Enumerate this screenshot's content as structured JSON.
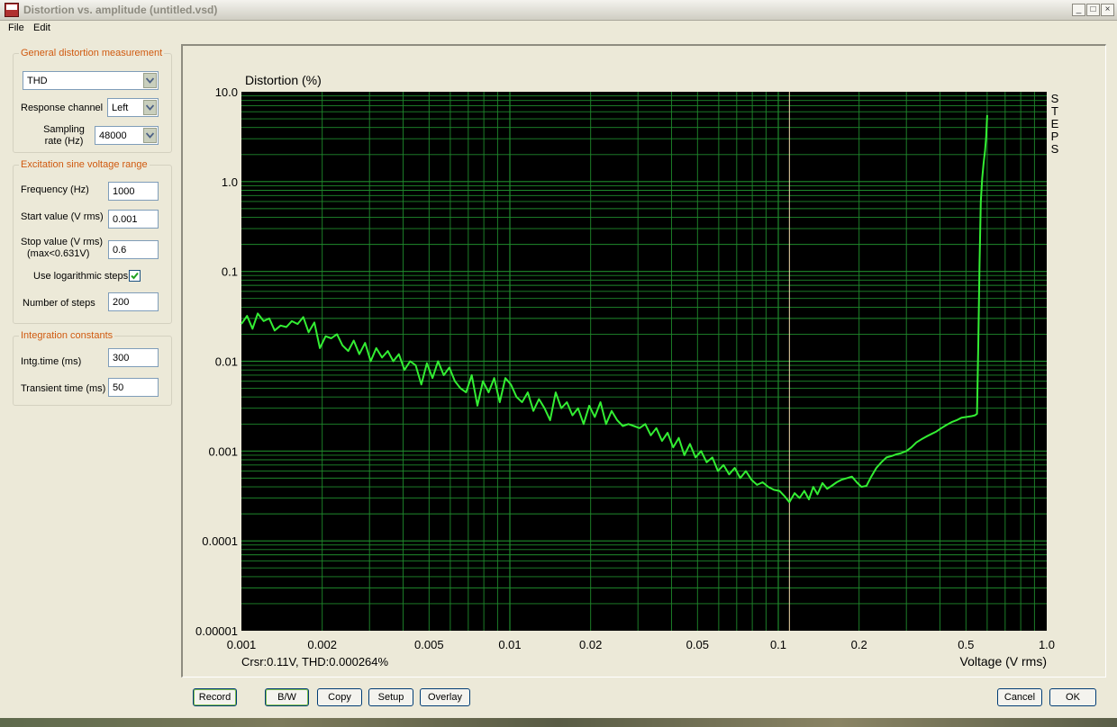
{
  "window": {
    "title": "Distortion vs. amplitude (untitled.vsd)",
    "app_icon_text": "Step"
  },
  "window_buttons": {
    "minimize": "_",
    "maximize": "□",
    "close": "×"
  },
  "menu": [
    "File",
    "Edit"
  ],
  "general": {
    "group_title": "General distortion measurement",
    "measurement_value": "THD",
    "response_channel_label": "Response channel",
    "response_channel_value": "Left",
    "sampling_rate_label_1": "Sampling",
    "sampling_rate_label_2": "rate (Hz)",
    "sampling_rate_value": "48000"
  },
  "excitation": {
    "group_title": "Excitation sine voltage range",
    "frequency_label": "Frequency (Hz)",
    "frequency_value": "1000",
    "start_label": "Start value (V rms)",
    "start_value": "0.001",
    "stop_label_1": "Stop value (V rms)",
    "stop_label_2": "(max<0.631V)",
    "stop_value": "0.6",
    "log_steps_label": "Use logarithmic steps",
    "log_steps_checked": true,
    "steps_label": "Number of steps",
    "steps_value": "200"
  },
  "integration": {
    "group_title": "Integration constants",
    "intg_label": "Intg.time (ms)",
    "intg_value": "300",
    "transient_label": "Transient time (ms)",
    "transient_value": "50"
  },
  "chart": {
    "cursor_readout": "Crsr:0.11V, THD:0.000264%",
    "side_label": [
      "S",
      "T",
      "E",
      "P",
      "S"
    ]
  },
  "buttons": {
    "record": "Record",
    "bw": "B/W",
    "copy": "Copy",
    "setup": "Setup",
    "overlay": "Overlay",
    "cancel": "Cancel",
    "ok": "OK"
  },
  "colors": {
    "plot_background": "#000000",
    "grid": "#1f8a2c",
    "trace": "#33ee33",
    "cursor_line": "#f0d8a8",
    "group_title": "#d05a10"
  },
  "chart_data": {
    "type": "line",
    "title": "",
    "ylabel": "Distortion (%)",
    "xlabel": "Voltage (V rms)",
    "x_scale": "log",
    "y_scale": "log",
    "xlim": [
      0.001,
      1.0
    ],
    "ylim": [
      1e-05,
      10.0
    ],
    "grid": true,
    "x_ticks": [
      {
        "value": 0.001,
        "label": "0.001"
      },
      {
        "value": 0.002,
        "label": "0.002"
      },
      {
        "value": 0.005,
        "label": "0.005"
      },
      {
        "value": 0.01,
        "label": "0.01"
      },
      {
        "value": 0.02,
        "label": "0.02"
      },
      {
        "value": 0.05,
        "label": "0.05"
      },
      {
        "value": 0.1,
        "label": "0.1"
      },
      {
        "value": 0.2,
        "label": "0.2"
      },
      {
        "value": 0.5,
        "label": "0.5"
      },
      {
        "value": 1.0,
        "label": "1.0"
      }
    ],
    "y_ticks": [
      {
        "value": 10,
        "label": "10.0"
      },
      {
        "value": 1,
        "label": "1.0"
      },
      {
        "value": 0.1,
        "label": "0.1"
      },
      {
        "value": 0.01,
        "label": "0.01"
      },
      {
        "value": 0.001,
        "label": "0.001"
      },
      {
        "value": 0.0001,
        "label": "0.0001"
      },
      {
        "value": 1e-05,
        "label": "0.00001"
      }
    ],
    "cursor_x": 0.11,
    "series": [
      {
        "points": [
          [
            0.001,
            0.026
          ],
          [
            0.00105,
            0.032
          ],
          [
            0.0011,
            0.023
          ],
          [
            0.00115,
            0.034
          ],
          [
            0.00121,
            0.028
          ],
          [
            0.00127,
            0.03
          ],
          [
            0.00133,
            0.022
          ],
          [
            0.0014,
            0.025
          ],
          [
            0.00147,
            0.024
          ],
          [
            0.00154,
            0.028
          ],
          [
            0.00162,
            0.026
          ],
          [
            0.0017,
            0.031
          ],
          [
            0.00178,
            0.021
          ],
          [
            0.00187,
            0.027
          ],
          [
            0.00196,
            0.014
          ],
          [
            0.00206,
            0.019
          ],
          [
            0.00216,
            0.018
          ],
          [
            0.00227,
            0.02
          ],
          [
            0.00238,
            0.015
          ],
          [
            0.0025,
            0.013
          ],
          [
            0.00262,
            0.017
          ],
          [
            0.00275,
            0.012
          ],
          [
            0.00289,
            0.016
          ],
          [
            0.00303,
            0.01
          ],
          [
            0.00318,
            0.014
          ],
          [
            0.00334,
            0.011
          ],
          [
            0.00351,
            0.013
          ],
          [
            0.00368,
            0.01
          ],
          [
            0.00386,
            0.012
          ],
          [
            0.00405,
            0.008
          ],
          [
            0.00425,
            0.01
          ],
          [
            0.00446,
            0.009
          ],
          [
            0.00468,
            0.0055
          ],
          [
            0.00491,
            0.0095
          ],
          [
            0.00515,
            0.0065
          ],
          [
            0.0054,
            0.01
          ],
          [
            0.00567,
            0.007
          ],
          [
            0.00595,
            0.0085
          ],
          [
            0.00624,
            0.006
          ],
          [
            0.00655,
            0.005
          ],
          [
            0.00687,
            0.0045
          ],
          [
            0.00721,
            0.007
          ],
          [
            0.00757,
            0.0032
          ],
          [
            0.00794,
            0.006
          ],
          [
            0.00833,
            0.0045
          ],
          [
            0.00874,
            0.0065
          ],
          [
            0.00917,
            0.0035
          ],
          [
            0.00962,
            0.0065
          ],
          [
            0.01009,
            0.0055
          ],
          [
            0.01059,
            0.004
          ],
          [
            0.01111,
            0.0035
          ],
          [
            0.01166,
            0.0045
          ],
          [
            0.01223,
            0.0028
          ],
          [
            0.01283,
            0.0038
          ],
          [
            0.01346,
            0.003
          ],
          [
            0.01412,
            0.0022
          ],
          [
            0.01482,
            0.0045
          ],
          [
            0.01555,
            0.003
          ],
          [
            0.01631,
            0.0035
          ],
          [
            0.01711,
            0.0025
          ],
          [
            0.01795,
            0.003
          ],
          [
            0.01883,
            0.002
          ],
          [
            0.01976,
            0.0032
          ],
          [
            0.02073,
            0.0024
          ],
          [
            0.02175,
            0.0035
          ],
          [
            0.02282,
            0.002
          ],
          [
            0.02394,
            0.0028
          ],
          [
            0.02512,
            0.0022
          ],
          [
            0.02635,
            0.0019
          ],
          [
            0.02765,
            0.002
          ],
          [
            0.02901,
            0.0019
          ],
          [
            0.03043,
            0.0018
          ],
          [
            0.03193,
            0.002
          ],
          [
            0.0335,
            0.0015
          ],
          [
            0.03514,
            0.0018
          ],
          [
            0.03687,
            0.0013
          ],
          [
            0.03868,
            0.0016
          ],
          [
            0.04058,
            0.0011
          ],
          [
            0.04258,
            0.0014
          ],
          [
            0.04467,
            0.0009
          ],
          [
            0.04687,
            0.0012
          ],
          [
            0.04917,
            0.00085
          ],
          [
            0.05159,
            0.001
          ],
          [
            0.05412,
            0.00075
          ],
          [
            0.05678,
            0.00085
          ],
          [
            0.05957,
            0.0006
          ],
          [
            0.0625,
            0.0007
          ],
          [
            0.06557,
            0.00055
          ],
          [
            0.06879,
            0.00065
          ],
          [
            0.07217,
            0.0005
          ],
          [
            0.07572,
            0.0006
          ],
          [
            0.07944,
            0.00048
          ],
          [
            0.08334,
            0.00042
          ],
          [
            0.08744,
            0.00045
          ],
          [
            0.09174,
            0.0004
          ],
          [
            0.09625,
            0.00037
          ],
          [
            0.10098,
            0.00036
          ],
          [
            0.10594,
            0.00031
          ],
          [
            0.11,
            0.00027
          ],
          [
            0.115,
            0.00034
          ],
          [
            0.12,
            0.0003
          ],
          [
            0.125,
            0.00036
          ],
          [
            0.13,
            0.00029
          ],
          [
            0.135,
            0.0004
          ],
          [
            0.14,
            0.00033
          ],
          [
            0.146,
            0.00044
          ],
          [
            0.152,
            0.00038
          ],
          [
            0.158,
            0.00041
          ],
          [
            0.165,
            0.00045
          ],
          [
            0.172,
            0.00048
          ],
          [
            0.18,
            0.0005
          ],
          [
            0.188,
            0.00052
          ],
          [
            0.196,
            0.00045
          ],
          [
            0.204,
            0.0004
          ],
          [
            0.213,
            0.00041
          ],
          [
            0.222,
            0.00052
          ],
          [
            0.232,
            0.00065
          ],
          [
            0.242,
            0.00075
          ],
          [
            0.253,
            0.00085
          ],
          [
            0.264,
            0.00088
          ],
          [
            0.275,
            0.00092
          ],
          [
            0.287,
            0.00095
          ],
          [
            0.3,
            0.001
          ],
          [
            0.313,
            0.0011
          ],
          [
            0.327,
            0.00125
          ],
          [
            0.341,
            0.00135
          ],
          [
            0.356,
            0.00145
          ],
          [
            0.372,
            0.00155
          ],
          [
            0.388,
            0.00165
          ],
          [
            0.405,
            0.0018
          ],
          [
            0.423,
            0.00195
          ],
          [
            0.442,
            0.0021
          ],
          [
            0.461,
            0.0022
          ],
          [
            0.481,
            0.00235
          ],
          [
            0.503,
            0.0024
          ],
          [
            0.525,
            0.00245
          ],
          [
            0.54,
            0.0025
          ],
          [
            0.55,
            0.0026
          ],
          [
            0.556,
            0.015
          ],
          [
            0.562,
            0.12
          ],
          [
            0.568,
            0.6
          ],
          [
            0.575,
            1.1
          ],
          [
            0.582,
            1.6
          ],
          [
            0.589,
            2.2
          ],
          [
            0.595,
            3.2
          ],
          [
            0.6,
            5.5
          ]
        ]
      }
    ]
  }
}
